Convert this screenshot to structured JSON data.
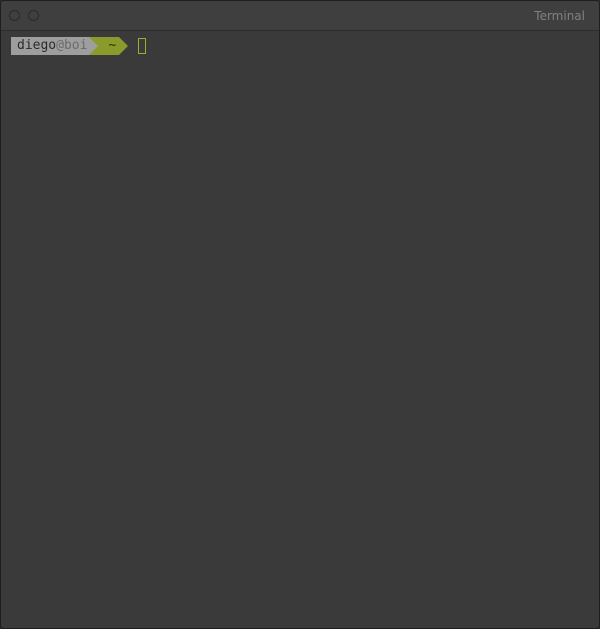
{
  "window": {
    "title": "Terminal"
  },
  "prompt": {
    "user": "diego",
    "at": "@",
    "host": "boi",
    "cwd": "~"
  },
  "input": {
    "value": ""
  },
  "colors": {
    "bg": "#3a3a3a",
    "titlebar": "#3f3f3f",
    "seg_grey": "#9e9e9e",
    "seg_olive": "#8a9a2b",
    "cursor_border": "#9aad2f"
  }
}
